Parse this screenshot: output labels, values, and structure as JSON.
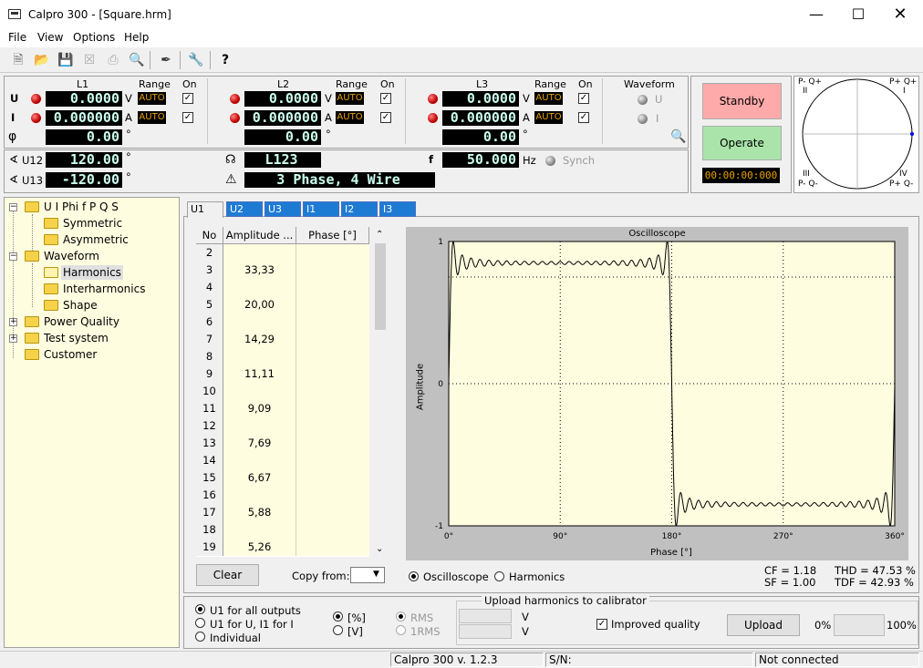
{
  "window": {
    "title": "Calpro 300 - [Square.hrm]"
  },
  "menu": [
    "File",
    "View",
    "Options",
    "Help"
  ],
  "lines": {
    "L1": {
      "name": "L1",
      "u": "0.0000",
      "u_unit": "V",
      "i": "0.000000",
      "i_unit": "A",
      "phi": "0.00",
      "u_range": "AUTO",
      "i_range": "AUTO"
    },
    "L2": {
      "name": "L2",
      "u": "0.0000",
      "u_unit": "V",
      "i": "0.000000",
      "i_unit": "A",
      "phi": "0.00",
      "u_range": "AUTO",
      "i_range": "AUTO"
    },
    "L3": {
      "name": "L3",
      "u": "0.0000",
      "u_unit": "V",
      "i": "0.000000",
      "i_unit": "A",
      "phi": "0.00",
      "u_range": "AUTO",
      "i_range": "AUTO"
    }
  },
  "labels": {
    "range": "Range",
    "on": "On",
    "u": "U",
    "i": "I",
    "phi": "φ",
    "deg": "°",
    "waveform": "Waveform",
    "wf_u": "U",
    "wf_i": "I",
    "u12": "U12",
    "u13": "U13",
    "f": "f",
    "hz": "Hz",
    "synch": "Synch"
  },
  "extra": {
    "u12": "120.00",
    "u13": "-120.00",
    "phase_seq": "L123",
    "f": "50.000",
    "connection": "3 Phase, 4 Wire"
  },
  "control": {
    "standby": "Standby",
    "operate": "Operate",
    "timer": "00:00:00:000"
  },
  "quadrant": {
    "q1": "P+ Q+",
    "q1n": "I",
    "q2": "P- Q+",
    "q2n": "II",
    "q3": "III",
    "q3b": "P- Q-",
    "q4": "IV",
    "q4b": "P+ Q-"
  },
  "tree": [
    {
      "label": "U I Phi f P Q S",
      "level": 0
    },
    {
      "label": "Symmetric",
      "level": 1
    },
    {
      "label": "Asymmetric",
      "level": 1
    },
    {
      "label": "Waveform",
      "level": 0
    },
    {
      "label": "Harmonics",
      "level": 1
    },
    {
      "label": "Interharmonics",
      "level": 1
    },
    {
      "label": "Shape",
      "level": 1
    },
    {
      "label": "Power Quality",
      "level": 0
    },
    {
      "label": "Test system",
      "level": 0
    },
    {
      "label": "Customer",
      "level": 0
    }
  ],
  "tabs": [
    "U1",
    "U2",
    "U3",
    "I1",
    "I2",
    "I3"
  ],
  "table": {
    "headers": [
      "No",
      "Amplitude ...",
      "Phase [°]"
    ],
    "rows": [
      [
        "2",
        ""
      ],
      [
        "3",
        "33,33"
      ],
      [
        "4",
        ""
      ],
      [
        "5",
        "20,00"
      ],
      [
        "6",
        ""
      ],
      [
        "7",
        "14,29"
      ],
      [
        "8",
        ""
      ],
      [
        "9",
        "11,11"
      ],
      [
        "10",
        ""
      ],
      [
        "11",
        "9,09"
      ],
      [
        "12",
        ""
      ],
      [
        "13",
        "7,69"
      ],
      [
        "14",
        ""
      ],
      [
        "15",
        "6,67"
      ],
      [
        "16",
        ""
      ],
      [
        "17",
        "5,88"
      ],
      [
        "18",
        ""
      ],
      [
        "19",
        "5,26"
      ]
    ]
  },
  "bottom": {
    "clear": "Clear",
    "copy_from": "Copy from:",
    "oscilloscope": "Oscilloscope",
    "harmonics": "Harmonics",
    "cf": "CF = 1.18",
    "sf": "SF = 1.00",
    "thd": "THD = 47.53 %",
    "tdf": "TDF = 42.93 %"
  },
  "upload": {
    "group": "Upload harmonics to calibrator",
    "opt1": "U1 for all outputs",
    "opt2": "U1 for U, I1 for I",
    "opt3": "Individual",
    "pct": "[%]",
    "v": "[V]",
    "rms": "RMS",
    "rms1": "1RMS",
    "vunit": "V",
    "improved": "Improved quality",
    "upload": "Upload",
    "p0": "0%",
    "p100": "100%",
    "progress": 0
  },
  "status": {
    "version": "Calpro 300 v. 1.2.3",
    "sn": "S/N:",
    "conn": "Not connected"
  },
  "chart_data": {
    "type": "line",
    "title": "Oscilloscope",
    "xlabel": "Phase [°]",
    "ylabel": "Amplitude",
    "xlim": [
      0,
      360
    ],
    "ylim": [
      -1,
      1
    ],
    "xticks": [
      "0°",
      "90°",
      "180°",
      "270°",
      "360°"
    ],
    "yticks": [
      "1",
      "0",
      "-1"
    ],
    "series": [
      {
        "harmonics_odd_max": 49,
        "fundamental": 1
      }
    ]
  }
}
